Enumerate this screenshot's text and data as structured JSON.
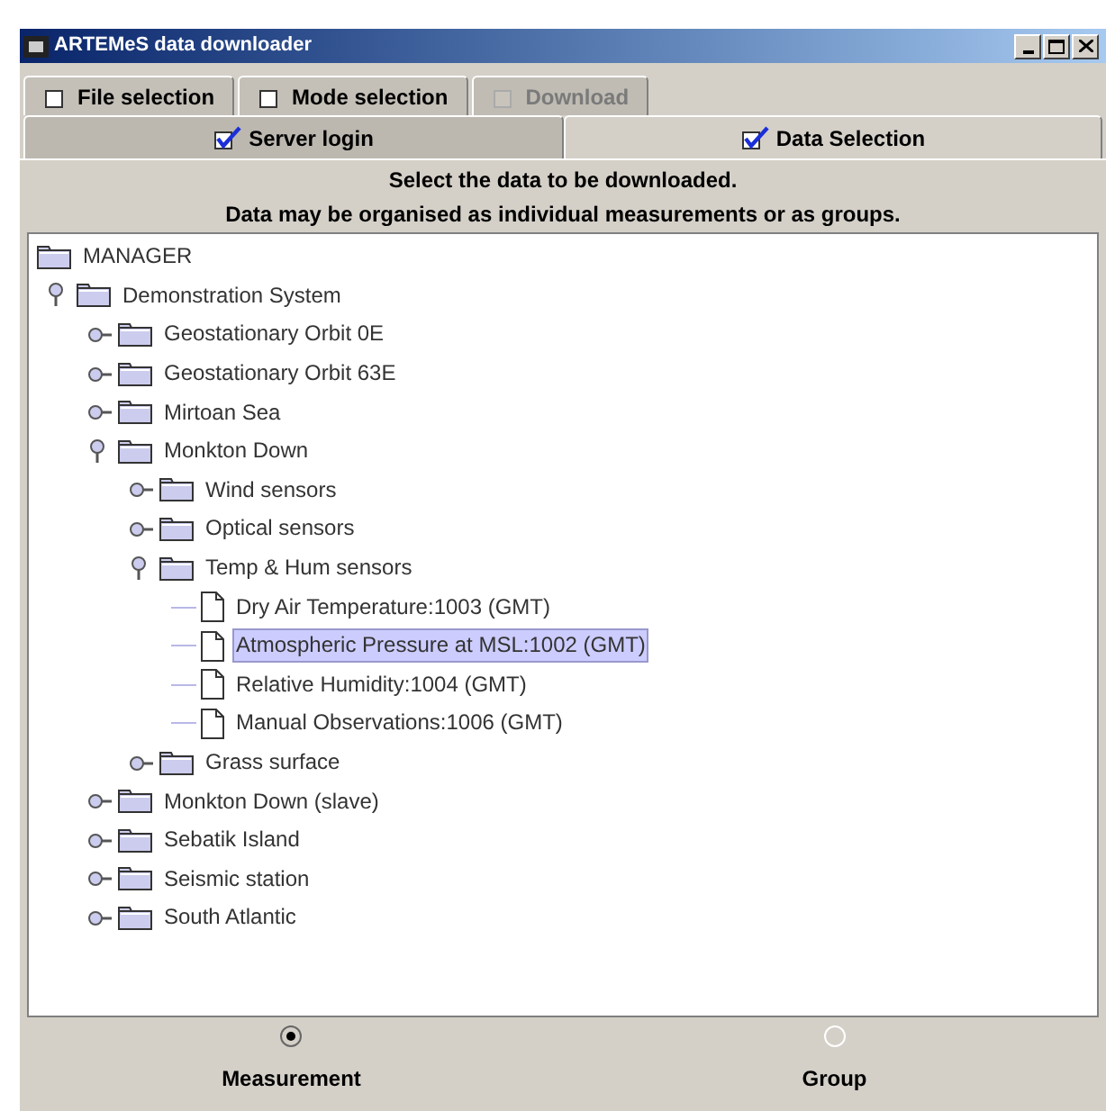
{
  "window": {
    "title": "ARTEMeS data downloader"
  },
  "tabs_back": [
    {
      "label": "File selection",
      "checked": false,
      "disabled": false
    },
    {
      "label": "Mode selection",
      "checked": false,
      "disabled": false
    },
    {
      "label": "Download",
      "checked": false,
      "disabled": true
    }
  ],
  "tabs_front": [
    {
      "label": "Server login",
      "checked": true,
      "selected": false
    },
    {
      "label": "Data Selection",
      "checked": true,
      "selected": true
    }
  ],
  "instructions": [
    "Select the data to be downloaded.",
    "Data may be organised as individual measurements or as groups."
  ],
  "tree": {
    "label": "MANAGER",
    "kind": "root",
    "children": [
      {
        "label": "Demonstration System",
        "kind": "folder",
        "expanded": true,
        "children": [
          {
            "label": "Geostationary Orbit 0E",
            "kind": "folder",
            "expanded": false
          },
          {
            "label": "Geostationary Orbit 63E",
            "kind": "folder",
            "expanded": false
          },
          {
            "label": "Mirtoan Sea",
            "kind": "folder",
            "expanded": false
          },
          {
            "label": "Monkton Down",
            "kind": "folder",
            "expanded": true,
            "children": [
              {
                "label": "Wind sensors",
                "kind": "folder",
                "expanded": false
              },
              {
                "label": "Optical sensors",
                "kind": "folder",
                "expanded": false
              },
              {
                "label": "Temp & Hum sensors",
                "kind": "folder",
                "expanded": true,
                "children": [
                  {
                    "label": "Dry Air Temperature:1003 (GMT)",
                    "kind": "file",
                    "selected": false
                  },
                  {
                    "label": "Atmospheric Pressure at MSL:1002 (GMT)",
                    "kind": "file",
                    "selected": true
                  },
                  {
                    "label": "Relative Humidity:1004 (GMT)",
                    "kind": "file",
                    "selected": false
                  },
                  {
                    "label": "Manual Observations:1006 (GMT)",
                    "kind": "file",
                    "selected": false
                  }
                ]
              },
              {
                "label": "Grass surface",
                "kind": "folder",
                "expanded": false
              }
            ]
          },
          {
            "label": "Monkton Down (slave)",
            "kind": "folder",
            "expanded": false
          },
          {
            "label": "Sebatik Island",
            "kind": "folder",
            "expanded": false
          },
          {
            "label": "Seismic station",
            "kind": "folder",
            "expanded": false
          },
          {
            "label": "South Atlantic",
            "kind": "folder",
            "expanded": false
          }
        ]
      }
    ]
  },
  "grouping": [
    {
      "label": "Measurement",
      "selected": true
    },
    {
      "label": "Group",
      "selected": false
    }
  ]
}
